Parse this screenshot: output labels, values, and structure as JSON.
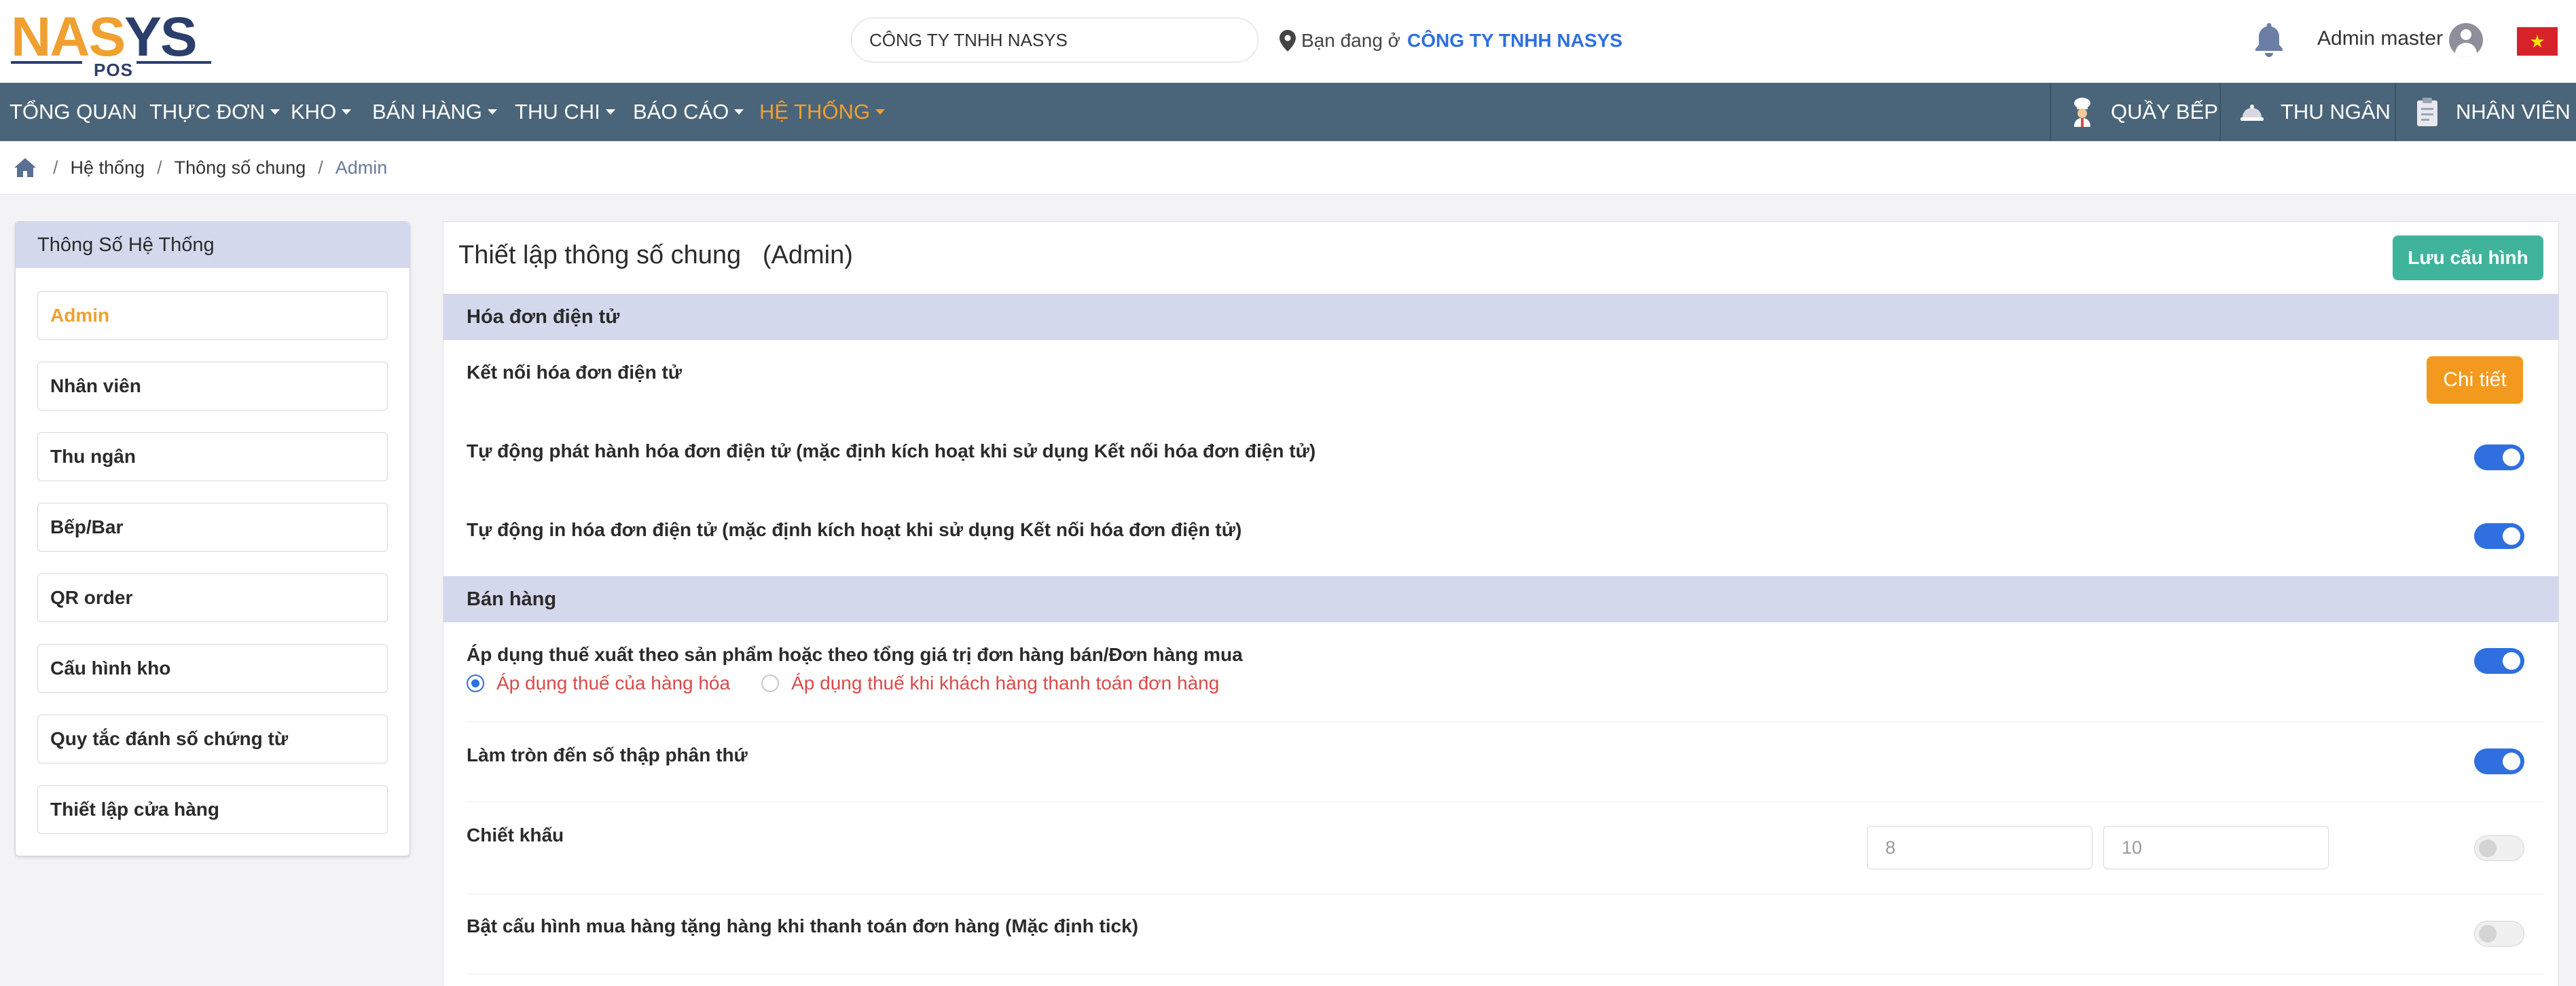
{
  "header": {
    "logo": {
      "text_na": "NA",
      "text_s": "S",
      "text_ys": "YS",
      "sub": "POS"
    },
    "company_field": {
      "value": "CÔNG TY TNHH NASYS"
    },
    "location": {
      "prefix": "Bạn đang ở",
      "company": "CÔNG TY TNHH NASYS"
    },
    "user_name": "Admin master",
    "flag": "★"
  },
  "nav": {
    "items": [
      {
        "label": "TỔNG QUAN"
      },
      {
        "label": "THỰC ĐƠN"
      },
      {
        "label": "KHO"
      },
      {
        "label": "BÁN HÀNG"
      },
      {
        "label": "THU CHI"
      },
      {
        "label": "BÁO CÁO"
      },
      {
        "label": "HỆ THỐNG"
      }
    ],
    "right": [
      {
        "label": "QUẦY BẾP",
        "icon": "chef-icon"
      },
      {
        "label": "THU NGÂN",
        "icon": "cashier-bell-icon"
      },
      {
        "label": "NHÂN VIÊN",
        "icon": "clipboard-icon"
      }
    ],
    "active_color": "#f0a030"
  },
  "breadcrumb": {
    "items": [
      "Hệ thống",
      "Thông số chung",
      "Admin"
    ]
  },
  "sidebar": {
    "title": "Thông Số Hệ Thống",
    "items": [
      {
        "label": "Admin"
      },
      {
        "label": "Nhân viên"
      },
      {
        "label": "Thu ngân"
      },
      {
        "label": "Bếp/Bar"
      },
      {
        "label": "QR order"
      },
      {
        "label": "Cấu hình kho"
      },
      {
        "label": "Quy tắc đánh số chứng từ"
      },
      {
        "label": "Thiết lập cửa hàng"
      }
    ]
  },
  "main": {
    "title": "Thiết lập thông số chung   (Admin)",
    "save_label": "Lưu cấu hình",
    "sections": {
      "invoice": {
        "title": "Hóa đơn điện tử",
        "connect_label": "Kết nối hóa đơn điện tử",
        "detail_label": "Chi tiết",
        "auto_issue_label": "Tự động phát hành hóa đơn điện tử (mặc định kích hoạt khi sử dụng Kết nối hóa đơn điện tử)",
        "auto_print_label": "Tự động in hóa đơn điện tử (mặc định kích hoạt khi sử dụng Kết nối hóa đơn điện tử)"
      },
      "sales": {
        "title": "Bán hàng",
        "tax_label": "Áp dụng thuế xuất theo sản phẩm hoặc theo tổng giá trị đơn hàng bán/Đơn hàng mua",
        "tax_option_product": "Áp dụng thuế của hàng hóa",
        "tax_option_payment": "Áp dụng thuế khi khách hàng thanh toán đơn hàng",
        "round_label": "Làm tròn đến số thập phân thứ",
        "discount_label": "Chiết khấu",
        "discount_value_1": "8",
        "discount_value_2": "10",
        "gift_label": "Bật cấu hình mua hàng tặng hàng khi thanh toán đơn hàng (Mặc định tick)"
      }
    },
    "toggles": {
      "auto_issue": true,
      "auto_print": true,
      "tax": true,
      "round": true,
      "discount": false,
      "gift": false
    },
    "colors": {
      "toggle_on": "#2f6fe0",
      "save": "#3fb49a",
      "detail": "#f39a1e",
      "option_text": "#d94a4a"
    }
  }
}
